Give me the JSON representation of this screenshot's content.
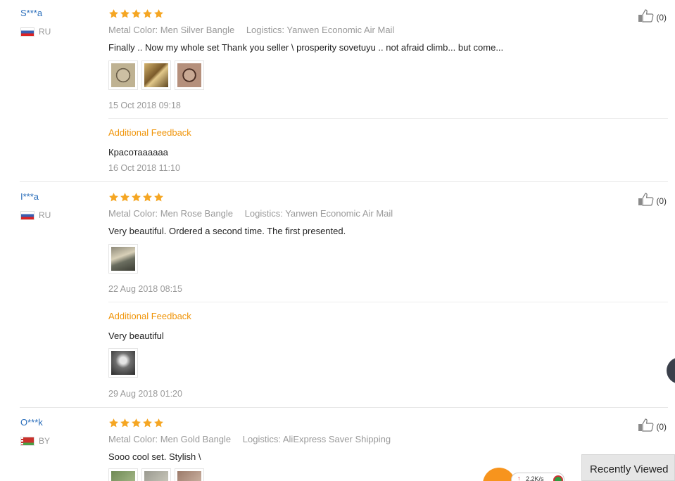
{
  "reviews": [
    {
      "user": "S***a",
      "country": "RU",
      "flag": "ru",
      "stars": 5,
      "color_label": "Metal Color: Men Silver Bangle",
      "logistics_label": "Logistics: Yanwen Economic Air Mail",
      "text": "Finally .. Now my whole set Thank you seller \\ prosperity sovetuyu .. not afraid climb... but come...",
      "date": "15 Oct 2018 09:18",
      "likes": "(0)",
      "additional": {
        "label": "Additional Feedback",
        "text": "Красотаааааа",
        "date": "16 Oct 2018 11:10"
      }
    },
    {
      "user": "I***a",
      "country": "RU",
      "flag": "ru",
      "stars": 5,
      "color_label": "Metal Color: Men Rose Bangle",
      "logistics_label": "Logistics: Yanwen Economic Air Mail",
      "text": "Very beautiful. Ordered a second time. The first presented.",
      "date": "22 Aug 2018 08:15",
      "likes": "(0)",
      "additional": {
        "label": "Additional Feedback",
        "text": "Very beautiful",
        "date": "29 Aug 2018 01:20"
      }
    },
    {
      "user": "O***k",
      "country": "BY",
      "flag": "by",
      "stars": 5,
      "color_label": "Metal Color: Men Gold Bangle",
      "logistics_label": "Logistics: AliExpress Saver Shipping",
      "text": "Sooo cool set. Stylish \\",
      "likes": "(0)"
    }
  ],
  "recently_viewed": "Recently Viewed",
  "widget": {
    "speed": "2.2K/s"
  },
  "colors": {
    "accent": "#f5a623",
    "link": "#2a6ebb",
    "feedback": "#f0950a",
    "muted": "#999999"
  },
  "icons": {
    "like": "thumbs-up-icon",
    "star": "star-icon"
  }
}
